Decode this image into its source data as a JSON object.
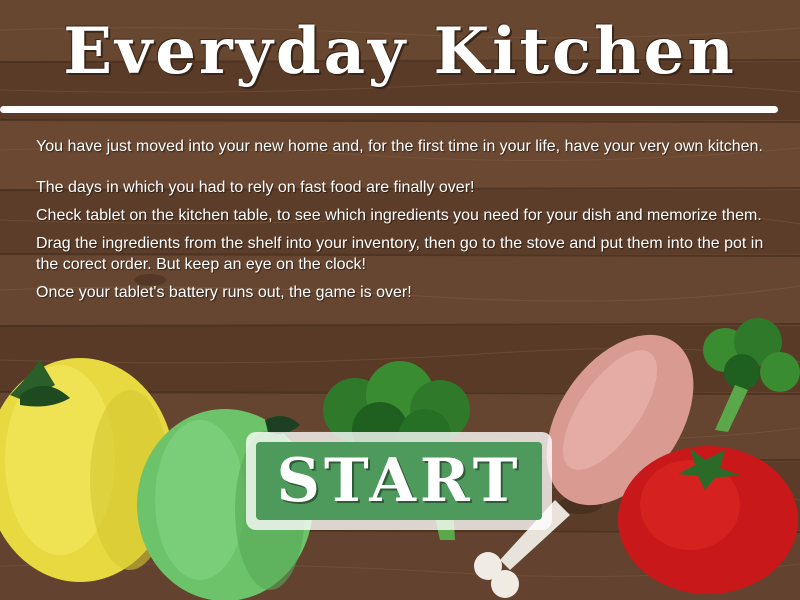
{
  "game": {
    "title": "Everyday Kitchen",
    "intro": {
      "p1": "You have just moved into your new home and, for the first time in your life, have your very own kitchen.",
      "p2": "The days in which you had to rely on fast food are finally over!",
      "p3": "Check tablet on the kitchen table, to see which ingredients you need for your dish and memorize them.",
      "p4": "Drag the ingredients from the shelf into your inventory, then go to the stove and put them into the pot in the corect order. But keep an eye on the clock!",
      "p5": "Once your tablet's battery runs out, the game is over!"
    },
    "start_label": "START"
  },
  "background": {
    "texture": "wood-planks",
    "color": "#5e3f2a"
  },
  "decorations": [
    "yellow-pepper",
    "green-pepper",
    "broccoli",
    "chicken-drumstick",
    "broccoli-small",
    "tomato"
  ],
  "colors": {
    "accent": "#4e9a5c",
    "title": "#ffffff",
    "text": "#ffffff"
  }
}
